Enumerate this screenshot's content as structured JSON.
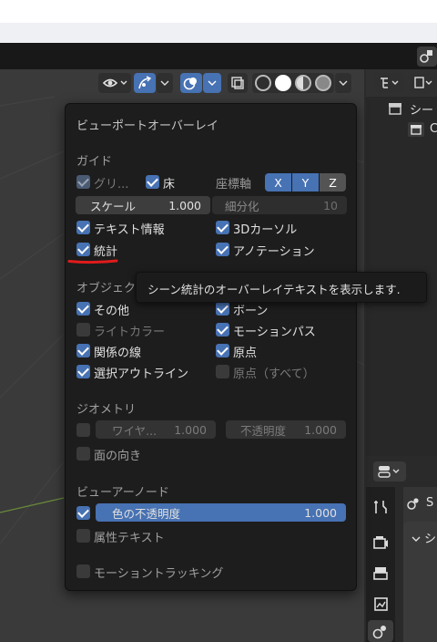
{
  "colors": {
    "accent": "#4772b3",
    "popup_bg": "#1d1d1d",
    "annotation": "#e01b1b"
  },
  "header": {
    "icons": [
      "visibility-icon",
      "gizmo-icon",
      "overlay-icon",
      "xray-icon",
      "wireframe-shading-icon",
      "solid-shading-icon",
      "material-shading-icon",
      "rendered-shading-icon"
    ]
  },
  "popup": {
    "title": "ビューポートオーバーレイ",
    "guides": {
      "heading": "ガイド",
      "grid": "グリ...",
      "floor": "床",
      "axes_label": "座標軸",
      "axis_x": "X",
      "axis_y": "Y",
      "axis_z": "Z",
      "scale_label": "スケール",
      "scale_value": "1.000",
      "subdiv_label": "細分化",
      "subdiv_value": "10",
      "text_info": "テキスト情報",
      "cursor_3d": "3Dカーソル",
      "statistics": "統計",
      "annotations": "アノテーション"
    },
    "objects": {
      "heading": "オブジェク",
      "extras": "その他",
      "bones": "ボーン",
      "light_colors": "ライトカラー",
      "motion_paths": "モーションパス",
      "relationship_lines": "関係の線",
      "origins": "原点",
      "outline_selected": "選択アウトライン",
      "origins_all": "原点（すべて）"
    },
    "geometry": {
      "heading": "ジオメトリ",
      "wireframe_label": "ワイヤ...",
      "wireframe_value": "1.000",
      "opacity_label": "不透明度",
      "opacity_value": "1.000",
      "face_orientation": "面の向き"
    },
    "viewer_node": {
      "heading": "ビューアーノード",
      "color_opacity_label": "色の不透明度",
      "color_opacity_value": "1.000",
      "attribute_text": "属性テキスト"
    },
    "motion_tracking": "モーショントラッキング"
  },
  "tooltip": "シーン統計のオーバーレイテキストを表示します.",
  "outliner": {
    "item_scene": "シー",
    "item_collection": "C"
  },
  "properties": {
    "scene_label": "S",
    "panel_label": "シ"
  }
}
